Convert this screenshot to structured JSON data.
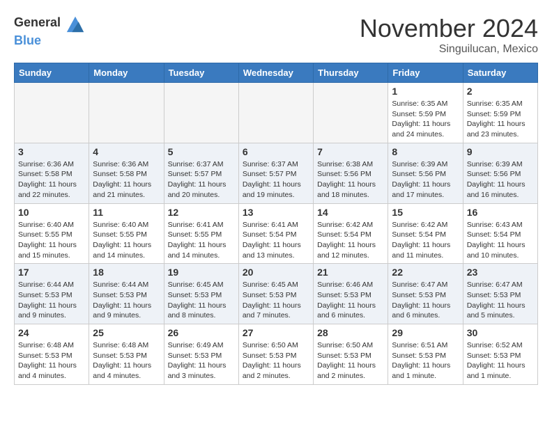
{
  "header": {
    "logo_general": "General",
    "logo_blue": "Blue",
    "month": "November 2024",
    "location": "Singuilucan, Mexico"
  },
  "days_of_week": [
    "Sunday",
    "Monday",
    "Tuesday",
    "Wednesday",
    "Thursday",
    "Friday",
    "Saturday"
  ],
  "weeks": [
    [
      {
        "day": "",
        "info": ""
      },
      {
        "day": "",
        "info": ""
      },
      {
        "day": "",
        "info": ""
      },
      {
        "day": "",
        "info": ""
      },
      {
        "day": "",
        "info": ""
      },
      {
        "day": "1",
        "info": "Sunrise: 6:35 AM\nSunset: 5:59 PM\nDaylight: 11 hours and 24 minutes."
      },
      {
        "day": "2",
        "info": "Sunrise: 6:35 AM\nSunset: 5:59 PM\nDaylight: 11 hours and 23 minutes."
      }
    ],
    [
      {
        "day": "3",
        "info": "Sunrise: 6:36 AM\nSunset: 5:58 PM\nDaylight: 11 hours and 22 minutes."
      },
      {
        "day": "4",
        "info": "Sunrise: 6:36 AM\nSunset: 5:58 PM\nDaylight: 11 hours and 21 minutes."
      },
      {
        "day": "5",
        "info": "Sunrise: 6:37 AM\nSunset: 5:57 PM\nDaylight: 11 hours and 20 minutes."
      },
      {
        "day": "6",
        "info": "Sunrise: 6:37 AM\nSunset: 5:57 PM\nDaylight: 11 hours and 19 minutes."
      },
      {
        "day": "7",
        "info": "Sunrise: 6:38 AM\nSunset: 5:56 PM\nDaylight: 11 hours and 18 minutes."
      },
      {
        "day": "8",
        "info": "Sunrise: 6:39 AM\nSunset: 5:56 PM\nDaylight: 11 hours and 17 minutes."
      },
      {
        "day": "9",
        "info": "Sunrise: 6:39 AM\nSunset: 5:56 PM\nDaylight: 11 hours and 16 minutes."
      }
    ],
    [
      {
        "day": "10",
        "info": "Sunrise: 6:40 AM\nSunset: 5:55 PM\nDaylight: 11 hours and 15 minutes."
      },
      {
        "day": "11",
        "info": "Sunrise: 6:40 AM\nSunset: 5:55 PM\nDaylight: 11 hours and 14 minutes."
      },
      {
        "day": "12",
        "info": "Sunrise: 6:41 AM\nSunset: 5:55 PM\nDaylight: 11 hours and 14 minutes."
      },
      {
        "day": "13",
        "info": "Sunrise: 6:41 AM\nSunset: 5:54 PM\nDaylight: 11 hours and 13 minutes."
      },
      {
        "day": "14",
        "info": "Sunrise: 6:42 AM\nSunset: 5:54 PM\nDaylight: 11 hours and 12 minutes."
      },
      {
        "day": "15",
        "info": "Sunrise: 6:42 AM\nSunset: 5:54 PM\nDaylight: 11 hours and 11 minutes."
      },
      {
        "day": "16",
        "info": "Sunrise: 6:43 AM\nSunset: 5:54 PM\nDaylight: 11 hours and 10 minutes."
      }
    ],
    [
      {
        "day": "17",
        "info": "Sunrise: 6:44 AM\nSunset: 5:53 PM\nDaylight: 11 hours and 9 minutes."
      },
      {
        "day": "18",
        "info": "Sunrise: 6:44 AM\nSunset: 5:53 PM\nDaylight: 11 hours and 9 minutes."
      },
      {
        "day": "19",
        "info": "Sunrise: 6:45 AM\nSunset: 5:53 PM\nDaylight: 11 hours and 8 minutes."
      },
      {
        "day": "20",
        "info": "Sunrise: 6:45 AM\nSunset: 5:53 PM\nDaylight: 11 hours and 7 minutes."
      },
      {
        "day": "21",
        "info": "Sunrise: 6:46 AM\nSunset: 5:53 PM\nDaylight: 11 hours and 6 minutes."
      },
      {
        "day": "22",
        "info": "Sunrise: 6:47 AM\nSunset: 5:53 PM\nDaylight: 11 hours and 6 minutes."
      },
      {
        "day": "23",
        "info": "Sunrise: 6:47 AM\nSunset: 5:53 PM\nDaylight: 11 hours and 5 minutes."
      }
    ],
    [
      {
        "day": "24",
        "info": "Sunrise: 6:48 AM\nSunset: 5:53 PM\nDaylight: 11 hours and 4 minutes."
      },
      {
        "day": "25",
        "info": "Sunrise: 6:48 AM\nSunset: 5:53 PM\nDaylight: 11 hours and 4 minutes."
      },
      {
        "day": "26",
        "info": "Sunrise: 6:49 AM\nSunset: 5:53 PM\nDaylight: 11 hours and 3 minutes."
      },
      {
        "day": "27",
        "info": "Sunrise: 6:50 AM\nSunset: 5:53 PM\nDaylight: 11 hours and 2 minutes."
      },
      {
        "day": "28",
        "info": "Sunrise: 6:50 AM\nSunset: 5:53 PM\nDaylight: 11 hours and 2 minutes."
      },
      {
        "day": "29",
        "info": "Sunrise: 6:51 AM\nSunset: 5:53 PM\nDaylight: 11 hours and 1 minute."
      },
      {
        "day": "30",
        "info": "Sunrise: 6:52 AM\nSunset: 5:53 PM\nDaylight: 11 hours and 1 minute."
      }
    ]
  ]
}
